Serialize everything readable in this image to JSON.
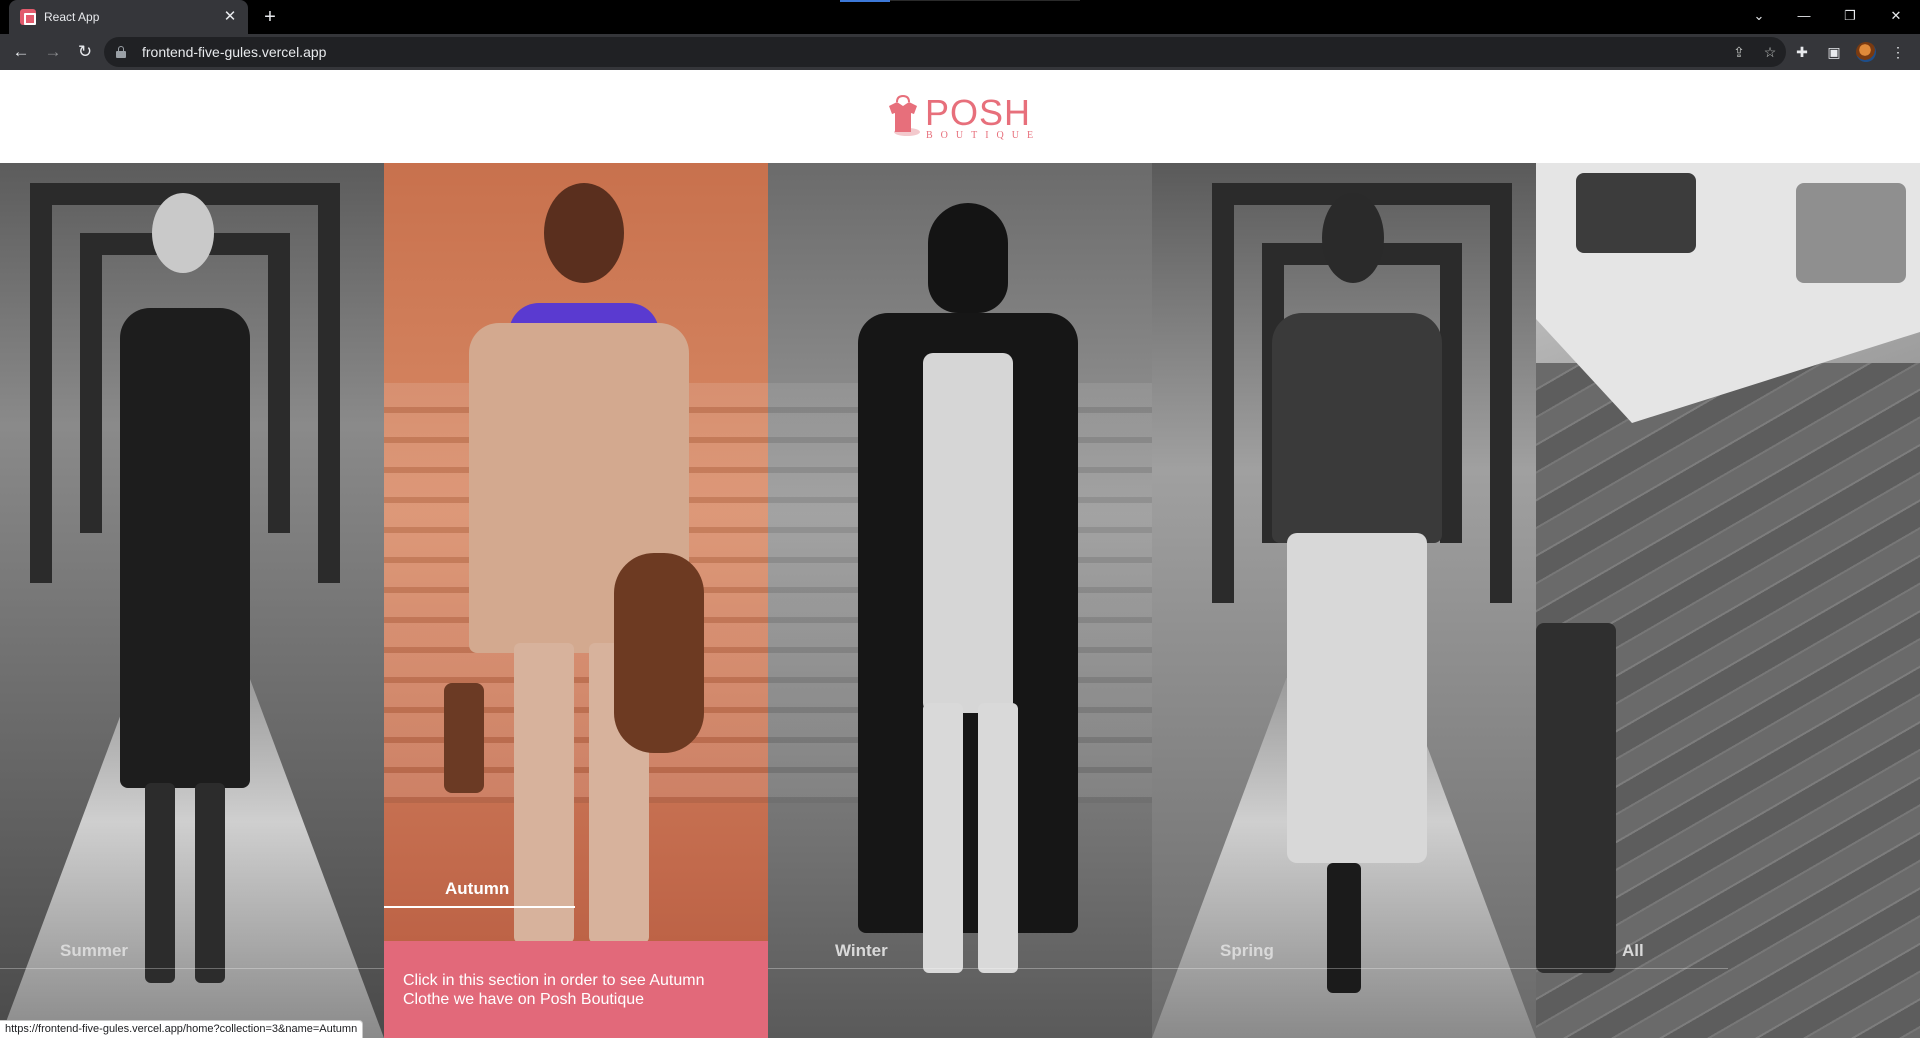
{
  "browser": {
    "tab_title": "React App",
    "tab_close": "✕",
    "new_tab": "+",
    "url": "frontend-five-gules.vercel.app",
    "status_url": "https://frontend-five-gules.vercel.app/home?collection=3&name=Autumn",
    "icons": {
      "back": "arrow-left-icon",
      "forward": "arrow-right-icon",
      "reload": "reload-icon",
      "lock": "lock-icon",
      "share": "share-icon",
      "bookmark": "star-icon",
      "extensions": "puzzle-icon",
      "side_panel": "side-panel-icon",
      "menu": "kebab-menu-icon"
    }
  },
  "site": {
    "logo_title": "POSH",
    "logo_subtitle": "BOUTIQUE",
    "brand_color": "#e76f7b"
  },
  "collections": [
    {
      "label": "Summer"
    },
    {
      "label": "Autumn",
      "active": true,
      "info": "Click in this section in order to see Autumn Clothe we have on Posh Boutique",
      "accent": "#e2697a"
    },
    {
      "label": "Winter"
    },
    {
      "label": "Spring"
    },
    {
      "label": "All"
    }
  ]
}
